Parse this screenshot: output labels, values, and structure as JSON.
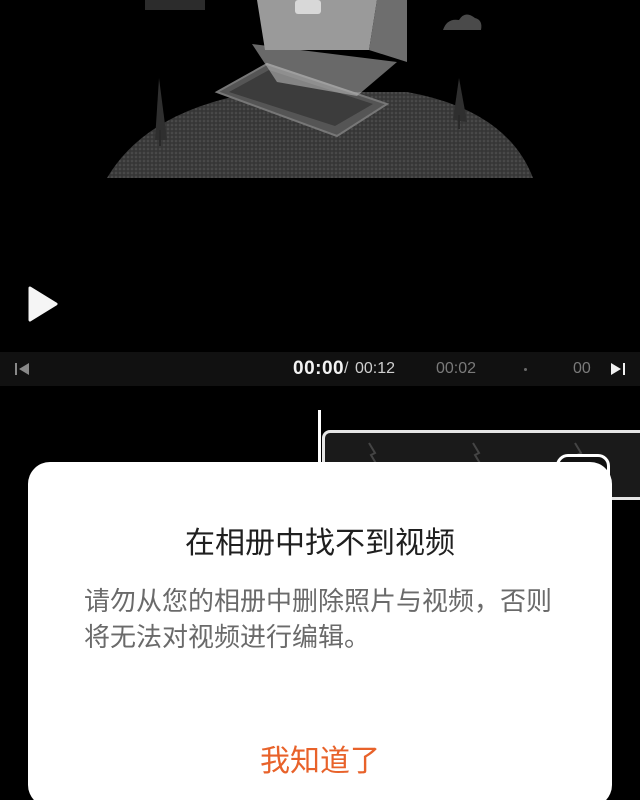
{
  "player": {
    "preview_icon": "illustration",
    "play_icon": "play-icon"
  },
  "timeline": {
    "current_time": "00:00",
    "separator": "/",
    "total_time": "00:12",
    "tick_1": "00:02",
    "tick_2": "00",
    "skip_start_icon": "skip-to-start-icon",
    "skip_end_icon": "skip-to-end-icon"
  },
  "dialog": {
    "title": "在相册中找不到视频",
    "message": "请勿从您的相册中删除照片与视频，否则将无法对视频进行编辑。",
    "confirm_label": "我知道了",
    "confirm_color": "#e8622a"
  }
}
